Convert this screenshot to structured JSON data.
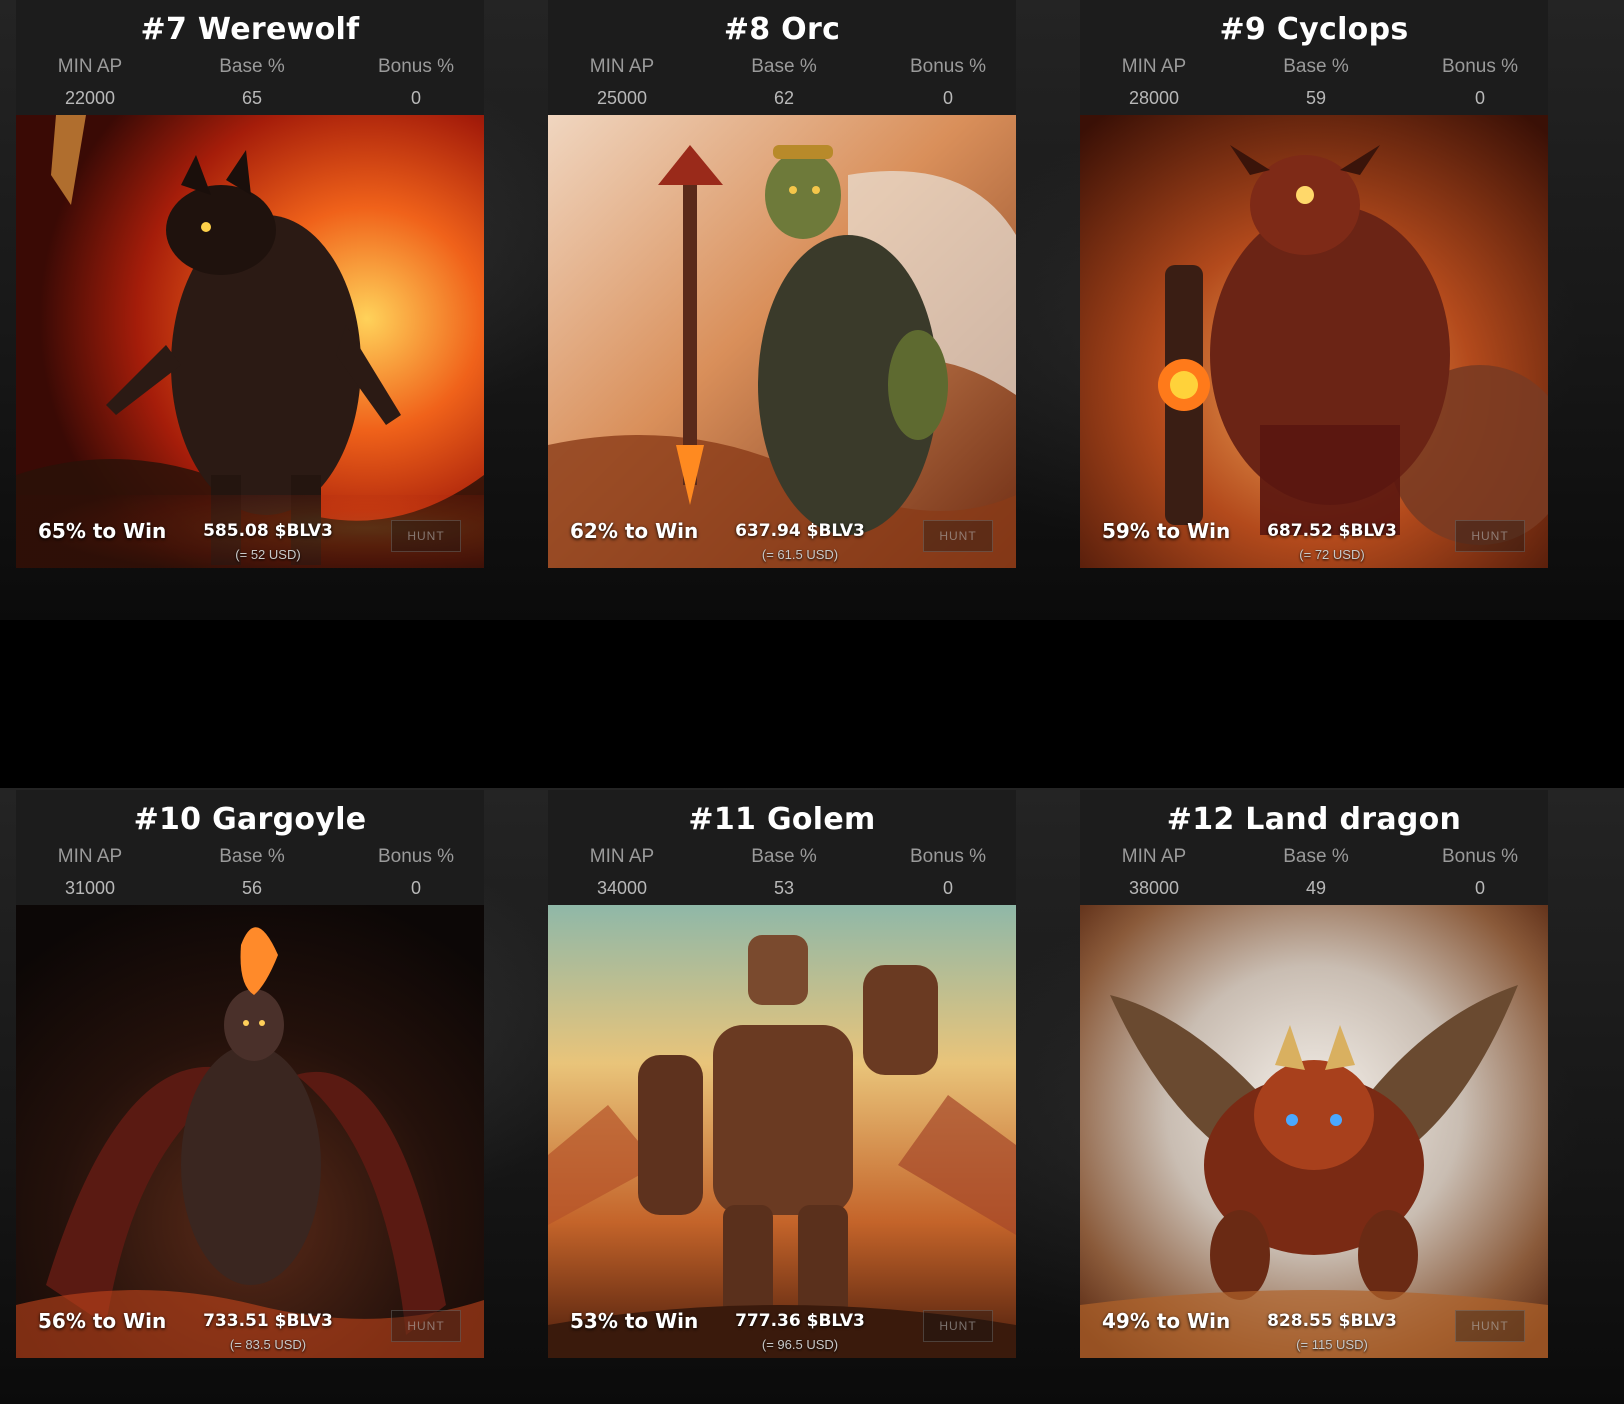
{
  "stat_labels": {
    "min_ap": "MIN AP",
    "base": "Base %",
    "bonus": "Bonus %"
  },
  "hunt_label": "HUNT",
  "cards": [
    {
      "title": "#7 Werewolf",
      "min_ap": "22000",
      "base": "65",
      "bonus": "0",
      "win": "65% to Win",
      "prize": "585.08 $BLV3",
      "usd": "(= 52 USD)",
      "art_icon": "werewolf-art"
    },
    {
      "title": "#8 Orc",
      "min_ap": "25000",
      "base": "62",
      "bonus": "0",
      "win": "62% to Win",
      "prize": "637.94 $BLV3",
      "usd": "(= 61.5 USD)",
      "art_icon": "orc-art"
    },
    {
      "title": "#9 Cyclops",
      "min_ap": "28000",
      "base": "59",
      "bonus": "0",
      "win": "59% to Win",
      "prize": "687.52 $BLV3",
      "usd": "(= 72 USD)",
      "art_icon": "cyclops-art"
    },
    {
      "title": "#10 Gargoyle",
      "min_ap": "31000",
      "base": "56",
      "bonus": "0",
      "win": "56% to Win",
      "prize": "733.51 $BLV3",
      "usd": "(= 83.5 USD)",
      "art_icon": "gargoyle-art"
    },
    {
      "title": "#11 Golem",
      "min_ap": "34000",
      "base": "53",
      "bonus": "0",
      "win": "53% to Win",
      "prize": "777.36 $BLV3",
      "usd": "(= 96.5 USD)",
      "art_icon": "golem-art"
    },
    {
      "title": "#12 Land dragon",
      "min_ap": "38000",
      "base": "49",
      "bonus": "0",
      "win": "49% to Win",
      "prize": "828.55 $BLV3",
      "usd": "(= 115 USD)",
      "art_icon": "land-dragon-art"
    }
  ],
  "colors": {
    "card_bg": "#1c1c1c",
    "page_bg": "#0c0c0c",
    "label_gray": "#9a9a9a",
    "value_gray": "#b8b8b8"
  }
}
